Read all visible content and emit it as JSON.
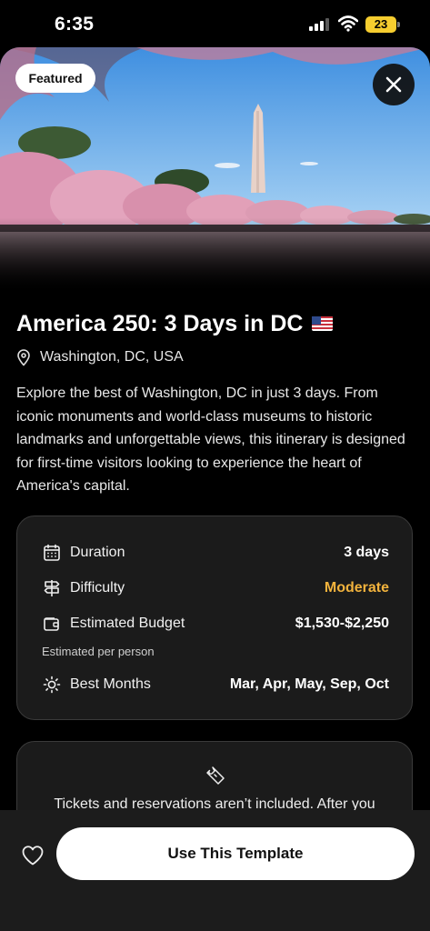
{
  "status_bar": {
    "time": "6:35",
    "battery": "23"
  },
  "hero": {
    "badge": "Featured"
  },
  "itinerary": {
    "title": "America 250: 3 Days in DC",
    "location": "Washington, DC, USA",
    "description": "Explore the best of Washington, DC in just 3 days. From iconic monuments and world-class museums to historic landmarks and unforgettable views, this itinerary is designed for first-time visitors looking to experience the heart of America's capital."
  },
  "details": {
    "duration": {
      "label": "Duration",
      "value": "3 days",
      "icon": "calendar-icon"
    },
    "difficulty": {
      "label": "Difficulty",
      "value": "Moderate",
      "icon": "signpost-icon",
      "color": "#f2b33d"
    },
    "budget": {
      "label": "Estimated Budget",
      "value": "$1,530-$2,250",
      "note": "Estimated per person",
      "icon": "wallet-icon"
    },
    "best_months": {
      "label": "Best Months",
      "value": "Mar, Apr, May, Sep, Oct",
      "icon": "sun-icon"
    }
  },
  "tickets": {
    "text": "Tickets and reservations aren’t included. After you",
    "icon": "ticket-icon"
  },
  "actions": {
    "primary": "Use This Template",
    "favorite_icon": "heart-icon"
  }
}
